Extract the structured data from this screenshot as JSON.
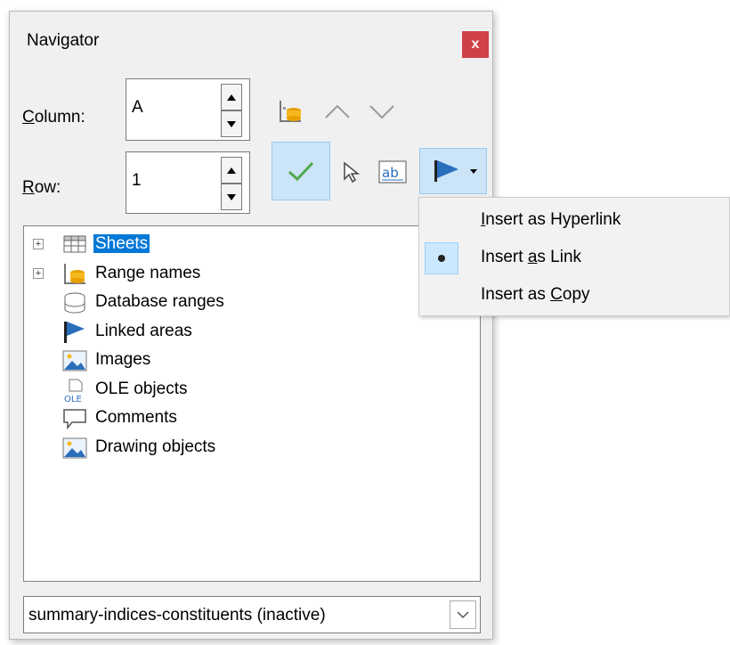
{
  "window": {
    "title": "Navigator",
    "close_label": "x"
  },
  "column": {
    "label_prefix": "",
    "label_key": "C",
    "label_rest": "olumn:",
    "value": "A"
  },
  "row": {
    "label_key": "R",
    "label_rest": "ow:",
    "value": "1"
  },
  "tree": {
    "items": [
      {
        "label": "Sheets",
        "expandable": true,
        "selected": true,
        "icon": "sheets-icon"
      },
      {
        "label": "Range names",
        "expandable": true,
        "selected": false,
        "icon": "range-names-icon"
      },
      {
        "label": "Database ranges",
        "expandable": false,
        "selected": false,
        "icon": "database-icon"
      },
      {
        "label": "Linked areas",
        "expandable": false,
        "selected": false,
        "icon": "flag-icon"
      },
      {
        "label": "Images",
        "expandable": false,
        "selected": false,
        "icon": "image-icon"
      },
      {
        "label": "OLE objects",
        "expandable": false,
        "selected": false,
        "icon": "ole-icon"
      },
      {
        "label": "Comments",
        "expandable": false,
        "selected": false,
        "icon": "comment-icon"
      },
      {
        "label": "Drawing objects",
        "expandable": false,
        "selected": false,
        "icon": "drawing-icon"
      }
    ]
  },
  "document_select": {
    "value": "summary-indices-constituents (inactive)"
  },
  "drag_mode_menu": {
    "items": [
      {
        "pre": "",
        "key": "I",
        "post": "nsert as Hyperlink",
        "checked": false
      },
      {
        "pre": "Insert ",
        "key": "a",
        "post": "s Link",
        "checked": true
      },
      {
        "pre": "Insert as ",
        "key": "C",
        "post": "opy",
        "checked": false
      }
    ]
  },
  "colors": {
    "accent": "#0078d7",
    "close": "#cf4146",
    "pressed": "#cce4f7"
  }
}
